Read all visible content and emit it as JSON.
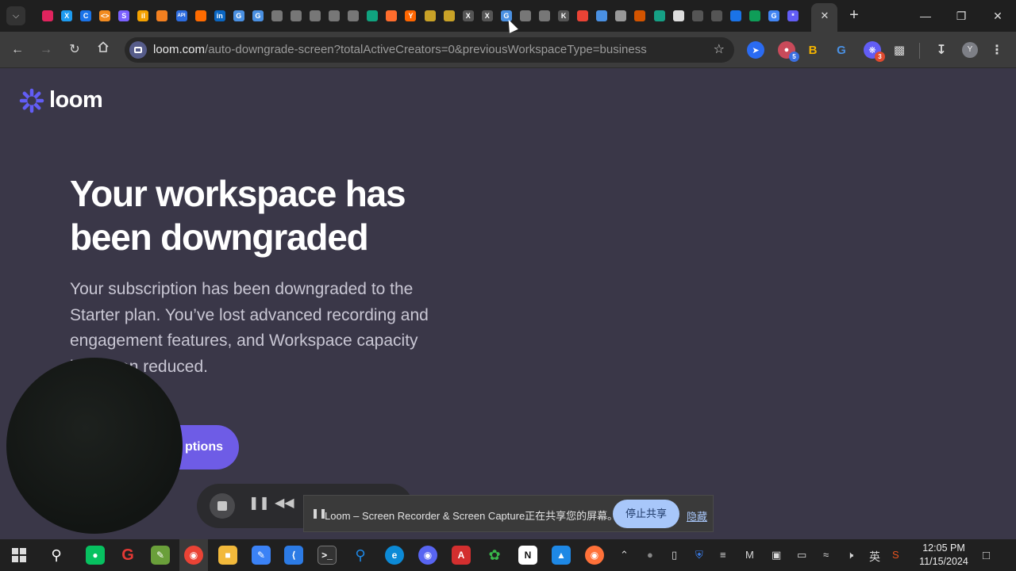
{
  "browser": {
    "pinned_tab_icons": [
      {
        "name": "recorder-tab-icon",
        "color": "#e0245e",
        "glyph": ""
      },
      {
        "name": "x-tab-icon",
        "color": "#1d9bf0",
        "glyph": "X"
      },
      {
        "name": "c-tab-icon",
        "color": "#1a73e8",
        "glyph": "C"
      },
      {
        "name": "code-tab-icon",
        "color": "#f28b20",
        "glyph": "<>"
      },
      {
        "name": "s-tab-icon",
        "color": "#7b61ff",
        "glyph": "S"
      },
      {
        "name": "chart-tab-icon",
        "color": "#f4a100",
        "glyph": "il"
      },
      {
        "name": "cloud-tab-icon",
        "color": "#f38020",
        "glyph": ""
      },
      {
        "name": "api-tab-icon",
        "color": "#2d6cdf",
        "glyph": "API"
      },
      {
        "name": "fire-tab-icon",
        "color": "#ff6b00",
        "glyph": ""
      },
      {
        "name": "linkedin-tab-icon",
        "color": "#0a66c2",
        "glyph": "in"
      },
      {
        "name": "g-tab-icon",
        "color": "#4a90e2",
        "glyph": "G"
      },
      {
        "name": "g2-tab-icon",
        "color": "#4a90e2",
        "glyph": "G"
      },
      {
        "name": "bug-tab-icon",
        "color": "#777777",
        "glyph": ""
      },
      {
        "name": "openai-tab-icon",
        "color": "#777777",
        "glyph": ""
      },
      {
        "name": "openai2-tab-icon",
        "color": "#777777",
        "glyph": ""
      },
      {
        "name": "github-tab-icon",
        "color": "#777777",
        "glyph": ""
      },
      {
        "name": "openai3-tab-icon",
        "color": "#777777",
        "glyph": ""
      },
      {
        "name": "green-tab-icon",
        "color": "#10a37f",
        "glyph": ""
      },
      {
        "name": "orange-tab-icon",
        "color": "#ff6d2d",
        "glyph": ""
      },
      {
        "name": "ycombinator-tab-icon",
        "color": "#ff6600",
        "glyph": "Y"
      },
      {
        "name": "coin-tab-icon",
        "color": "#c9a227",
        "glyph": ""
      },
      {
        "name": "coin2-tab-icon",
        "color": "#c9a227",
        "glyph": ""
      },
      {
        "name": "x2-tab-icon",
        "color": "#555555",
        "glyph": "X"
      },
      {
        "name": "x3-tab-icon",
        "color": "#555555",
        "glyph": "X"
      },
      {
        "name": "g3-tab-icon",
        "color": "#4a90e2",
        "glyph": "G"
      },
      {
        "name": "github2-tab-icon",
        "color": "#777777",
        "glyph": ""
      },
      {
        "name": "github3-tab-icon",
        "color": "#777777",
        "glyph": ""
      },
      {
        "name": "k-tab-icon",
        "color": "#555555",
        "glyph": "K"
      },
      {
        "name": "chrome-tab-icon",
        "color": "#ea4335",
        "glyph": ""
      },
      {
        "name": "people-tab-icon",
        "color": "#4a90e2",
        "glyph": ""
      },
      {
        "name": "face-tab-icon",
        "color": "#999999",
        "glyph": ""
      },
      {
        "name": "image-tab-icon",
        "color": "#d35400",
        "glyph": ""
      },
      {
        "name": "image2-tab-icon",
        "color": "#16a085",
        "glyph": ""
      },
      {
        "name": "square-tab-icon",
        "color": "#dddddd",
        "glyph": ""
      },
      {
        "name": "circle-tab-icon",
        "color": "#555555",
        "glyph": ""
      },
      {
        "name": "circle2-tab-icon",
        "color": "#555555",
        "glyph": ""
      },
      {
        "name": "puzzle-tab-icon",
        "color": "#1a73e8",
        "glyph": ""
      },
      {
        "name": "teal-tab-icon",
        "color": "#0f9d58",
        "glyph": ""
      },
      {
        "name": "google-tab-icon",
        "color": "#4285f4",
        "glyph": "G"
      },
      {
        "name": "loom-tab-icon",
        "color": "#625df5",
        "glyph": "*"
      }
    ],
    "url_host": "loom.com",
    "url_path": "/auto-downgrade-screen?totalActiveCreators=0&previousWorkspaceType=business",
    "extension_badges": {
      "first": "5",
      "second": "3"
    },
    "profile_initial": "Y"
  },
  "page": {
    "logo_text": "loom",
    "headline": "Your workspace has been downgraded",
    "subtext": "Your subscription has been downgraded to the Starter plan. You’ve lost advanced recording and engagement features, and Workspace capacity has been reduced.",
    "cta_label": "ptions"
  },
  "share_bar": {
    "message": "Loom – Screen Recorder & Screen Capture正在共享您的屏幕。",
    "stop_label": "停止共享",
    "hide_label": "隐藏"
  },
  "taskbar": {
    "ime_label": "英",
    "time": "12:05 PM",
    "date": "11/15/2024"
  },
  "colors": {
    "page_bg": "#3a3748",
    "brand": "#625df5",
    "cta": "#6e5ce6"
  }
}
